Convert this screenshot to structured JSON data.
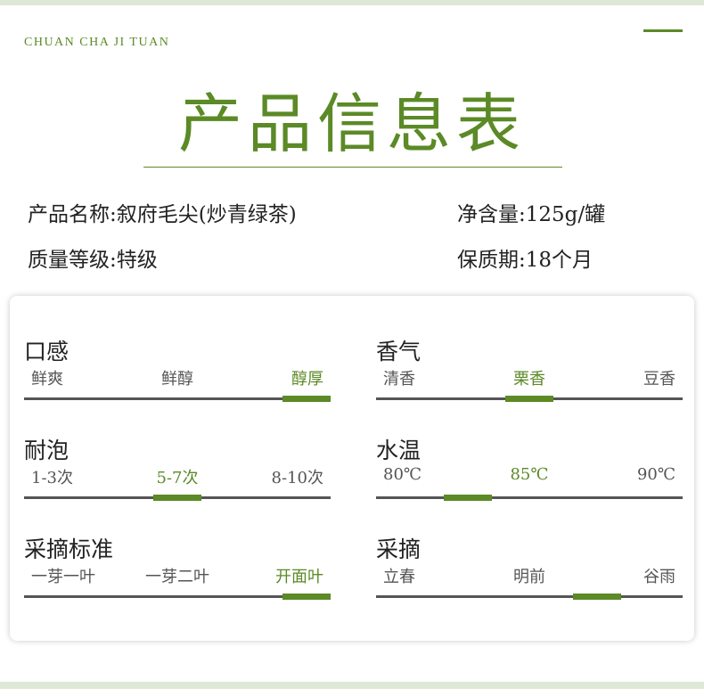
{
  "brand": {
    "text": "CHUAN CHA JI TUAN"
  },
  "title": "产品信息表",
  "info": {
    "name": "产品名称:叙府毛尖(炒青绿茶)",
    "weight": "净含量:125g/罐",
    "grade": "质量等级:特级",
    "shelf_life": "保质期:18个月"
  },
  "attributes": [
    {
      "label": "口感",
      "options": [
        "鲜爽",
        "鲜醇",
        "醇厚"
      ],
      "selected_index": 2,
      "marker_position": 0.93
    },
    {
      "label": "香气",
      "options": [
        "清香",
        "栗香",
        "豆香"
      ],
      "selected_index": 1,
      "marker_position": 0.5
    },
    {
      "label": "耐泡",
      "options": [
        "1-3次",
        "5-7次",
        "8-10次"
      ],
      "selected_index": 1,
      "marker_position": 0.5
    },
    {
      "label": "水温",
      "options": [
        "80℃",
        "85℃",
        "90℃"
      ],
      "selected_index": 1,
      "marker_position": 0.3
    },
    {
      "label": "采摘标准",
      "options": [
        "一芽一叶",
        "一芽二叶",
        "开面叶"
      ],
      "selected_index": 2,
      "marker_position": 0.93
    },
    {
      "label": "采摘",
      "options": [
        "立春",
        "明前",
        "谷雨"
      ],
      "selected_index": null,
      "marker_position": 0.72
    }
  ],
  "colors": {
    "accent": "#5b8a26",
    "text": "#222222",
    "muted": "#555555",
    "stripe": "#dfe7d6"
  }
}
